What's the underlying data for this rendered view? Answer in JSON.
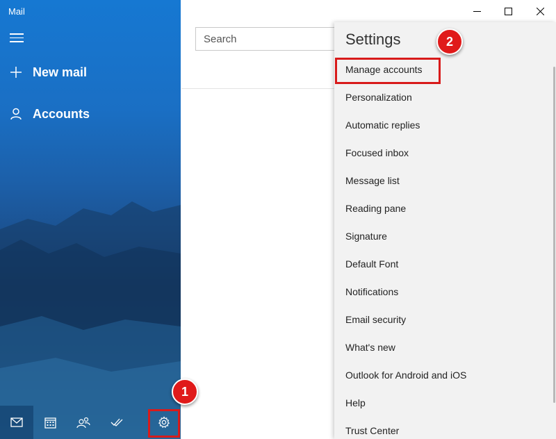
{
  "app": {
    "title": "Mail"
  },
  "nav": {
    "new_mail": "New mail",
    "accounts": "Accounts",
    "icons": [
      "hamburger-icon",
      "plus-icon",
      "person-icon"
    ]
  },
  "bottom_bar": {
    "icons": [
      "mail-icon",
      "calendar-icon",
      "people-icon",
      "todo-icon",
      "gear-icon"
    ]
  },
  "search": {
    "placeholder": "Search"
  },
  "window_controls": [
    "minimize-icon",
    "maximize-icon",
    "close-icon"
  ],
  "settings": {
    "title": "Settings",
    "items": [
      "Manage accounts",
      "Personalization",
      "Automatic replies",
      "Focused inbox",
      "Message list",
      "Reading pane",
      "Signature",
      "Default Font",
      "Notifications",
      "Email security",
      "What's new",
      "Outlook for Android and iOS",
      "Help",
      "Trust Center"
    ]
  },
  "annotations": {
    "step1": "1",
    "step2": "2"
  },
  "colors": {
    "accent": "#0078d7",
    "highlight": "#d81b1b"
  }
}
